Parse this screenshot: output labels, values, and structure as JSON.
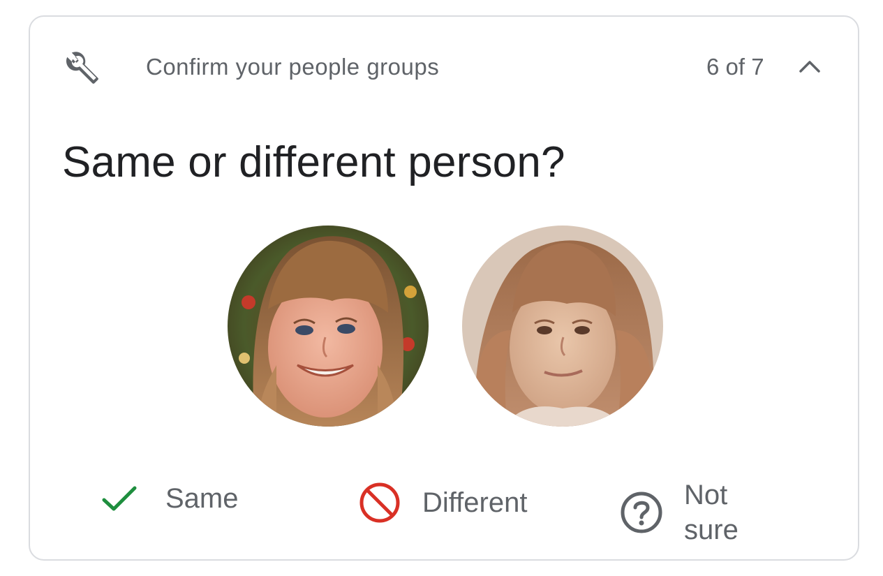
{
  "card": {
    "header": {
      "icon": "wrench-icon",
      "title": "Confirm your people groups",
      "counter": "6 of 7",
      "collapse_icon": "chevron-up-icon"
    },
    "question": "Same or different person?",
    "faces": [
      {
        "description": "face-photo-1"
      },
      {
        "description": "face-photo-2"
      }
    ],
    "actions": {
      "same": {
        "label": "Same",
        "icon": "check-icon",
        "color": "#1e8e3e"
      },
      "different": {
        "label": "Different",
        "icon": "block-icon",
        "color": "#d93025"
      },
      "not_sure": {
        "label": "Not sure",
        "icon": "help-circle-icon",
        "color": "#5f6368"
      }
    }
  }
}
